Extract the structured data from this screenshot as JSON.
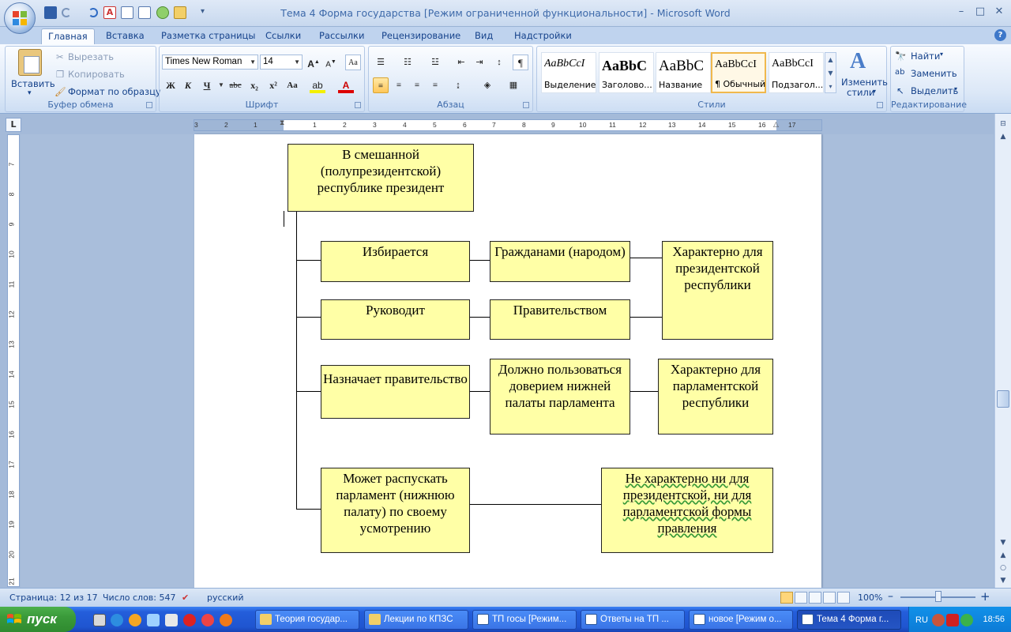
{
  "window": {
    "title": "Тема 4 Форма государства [Режим ограниченной функциональности] - Microsoft Word",
    "buttons": {
      "minimize": "–",
      "maximize": "□",
      "close": "✕"
    }
  },
  "ribbon_tabs": [
    "Главная",
    "Вставка",
    "Разметка страницы",
    "Ссылки",
    "Рассылки",
    "Рецензирование",
    "Вид",
    "Надстройки"
  ],
  "clipboard": {
    "paste": "Вставить",
    "cut": "Вырезать",
    "copy": "Копировать",
    "format_painter": "Формат по образцу",
    "label": "Буфер обмена"
  },
  "font": {
    "name": "Times New Roman",
    "size": "14",
    "label": "Шрифт",
    "bold": "Ж",
    "italic": "К",
    "underline": "Ч",
    "strike": "abc",
    "subscript": "x₂",
    "superscript": "x²",
    "case": "Aa",
    "grow": "A",
    "shrink": "A",
    "color_letter": "A"
  },
  "paragraph": {
    "label": "Абзац"
  },
  "styles": {
    "label": "Стили",
    "items": [
      {
        "sample": "AaBbCcI",
        "name": "Выделение"
      },
      {
        "sample": "AaBbC",
        "name": "Заголово..."
      },
      {
        "sample": "AaBbC",
        "name": "Название"
      },
      {
        "sample": "AaBbCcI",
        "name": "¶ Обычный"
      },
      {
        "sample": "AaBbCcI",
        "name": "Подзагол..."
      }
    ],
    "change_line1": "Изменить",
    "change_line2": "стили"
  },
  "editing": {
    "label": "Редактирование",
    "find": "Найти",
    "replace": "Заменить",
    "select": "Выделить"
  },
  "ruler": {
    "corner": "L",
    "numbers": [
      "3",
      "2",
      "1",
      "1",
      "2",
      "3",
      "4",
      "5",
      "6",
      "7",
      "8",
      "9",
      "10",
      "11",
      "12",
      "13",
      "14",
      "15",
      "16",
      "17"
    ],
    "vnumbers": [
      "7",
      "8",
      "9",
      "10",
      "11",
      "12",
      "13",
      "14",
      "15",
      "16",
      "17",
      "18",
      "19",
      "20",
      "21"
    ]
  },
  "diagram": {
    "root": "В смешанной (полупрезидентской) республике президент",
    "rows": [
      {
        "action": "Избирается",
        "detail": "Гражданами (народом)"
      },
      {
        "action": "Руководит",
        "detail": "Правительством"
      },
      {
        "action": "Назначает правительство",
        "detail": "Должно пользоваться доверием нижней палаты парламента"
      },
      {
        "action": "Может распускать парламент (нижнюю палату) по своему усмотрению"
      }
    ],
    "verdict_presidential": "Характерно для президентской республики",
    "verdict_parliamentary": "Характерно для парламентской республики",
    "verdict_neither": "Не характерно ни для президентской, ни для парламентской формы правления"
  },
  "status": {
    "page": "Страница: 12 из 17",
    "words": "Число слов: 547",
    "language": "русский",
    "zoom": "100%",
    "zoom_out": "–",
    "zoom_in": "+"
  },
  "taskbar": {
    "start": "пуск",
    "tasks": [
      {
        "label": "Теория государ...",
        "active": false
      },
      {
        "label": "Лекции по КПЗС",
        "active": false
      },
      {
        "label": "ТП госы [Режим...",
        "active": false
      },
      {
        "label": "Ответы на ТП ...",
        "active": false
      },
      {
        "label": "новое [Режим о...",
        "active": false
      },
      {
        "label": "Тема 4 Форма г...",
        "active": true
      }
    ],
    "lang": "RU",
    "clock": "18:56"
  },
  "colors": {
    "box_fill": "#ffffa6",
    "ribbon_text": "#15428b",
    "taskbar": "#245edb",
    "start": "#3a9a3a"
  }
}
